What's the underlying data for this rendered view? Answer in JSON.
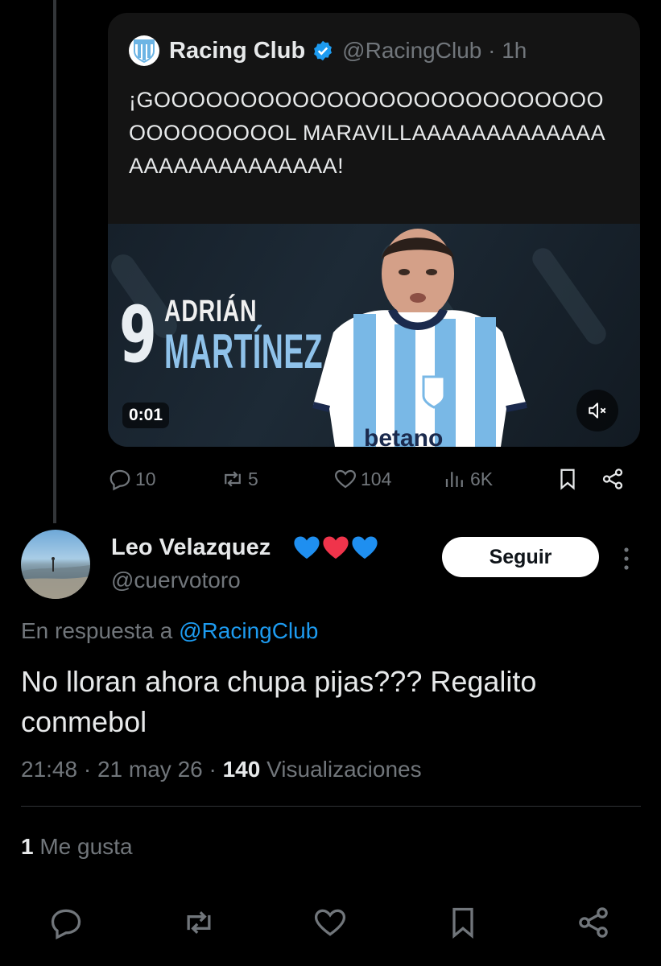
{
  "quoted_tweet": {
    "author_name": "Racing Club",
    "author_handle": "@RacingClub · 1h",
    "text": "¡GOOOOOOOOOOOOOOOOOOOOOOOOOOOOOOOOOOOL MARAVILLAAAAAAAAAAAAAAAAAAAAAAAAAAA!",
    "video": {
      "jersey_number": "9",
      "player_first_name": "ADRIÁN",
      "player_last_name": "MARTÍNEZ",
      "sponsor_text": "betano",
      "timestamp": "0:01"
    },
    "actions": {
      "replies": "10",
      "retweets": "5",
      "likes": "104",
      "views": "6K"
    }
  },
  "reply": {
    "author_name": "Leo Velazquez",
    "author_handle": "@cuervotoro",
    "follow_label": "Seguir",
    "reply_to_prefix": "En respuesta a",
    "reply_to_mention": "@RacingClub",
    "text": "No lloran ahora chupa pijas??? Regalito conmebol",
    "time": "21:48",
    "date": "21 may 26",
    "views_count": "140",
    "views_label": "Visualizaciones",
    "likes_count": "1",
    "likes_label": "Me gusta"
  },
  "colors": {
    "background": "#000000",
    "card": "#141414",
    "muted": "#71767b",
    "link": "#1d9bf0",
    "text": "#e7e9ea"
  }
}
